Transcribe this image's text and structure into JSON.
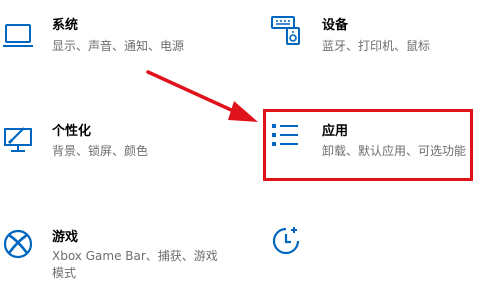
{
  "colors": {
    "accent": "#0067c0",
    "highlight": "#e0121b",
    "desc": "#6e6e6e"
  },
  "tiles": [
    {
      "title": "系统",
      "desc": [
        "显示、声音、通知、电源"
      ],
      "icon": "laptop-icon"
    },
    {
      "title": "设备",
      "desc": [
        "蓝牙、打印机、鼠标"
      ],
      "icon": "devices-icon"
    },
    {
      "title": "个性化",
      "desc": [
        "背景、锁屏、颜色"
      ],
      "icon": "personalization-icon"
    },
    {
      "title": "应用",
      "desc": [
        "卸载、默认应用、可选功能"
      ],
      "icon": "apps-icon"
    },
    {
      "title": "游戏",
      "desc": [
        "Xbox Game Bar、捕获、游戏",
        "模式"
      ],
      "icon": "xbox-icon"
    },
    {
      "title": "",
      "desc": [],
      "icon": "time-language-icon"
    }
  ]
}
